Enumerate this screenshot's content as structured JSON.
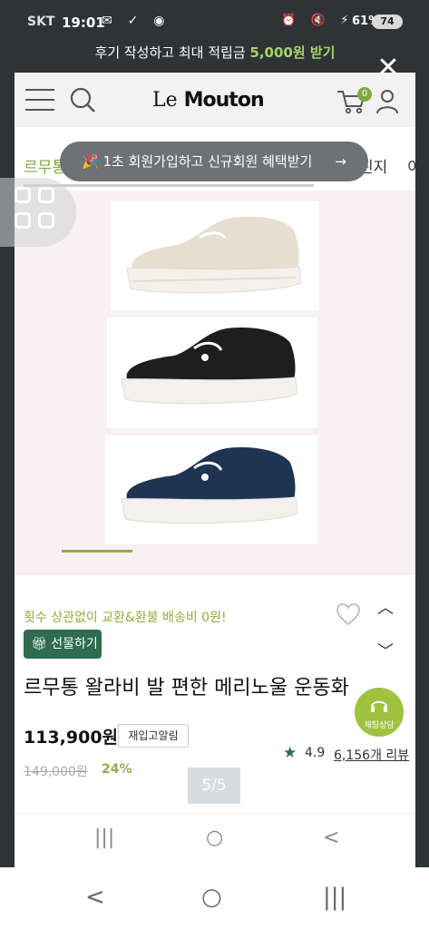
{
  "status_bar": {
    "carrier": "SKT",
    "time": "19:01",
    "battery": "61%",
    "battery_pill": "74"
  },
  "promo_banner": {
    "text": "후기 작성하고 최대 적립금 ",
    "highlight": "5,000원 받기"
  },
  "header": {
    "logo_le": "Le",
    "logo_mouton": "Mouton",
    "cart_count": "0"
  },
  "categories": {
    "first": "르무통",
    "middle": "린지",
    "last": "이"
  },
  "signup_pill": {
    "text": "🎉 1초 회원가입하고 신규회원 혜택받기",
    "arrow": "→"
  },
  "product": {
    "free_shipping": "횟수 상관없이 교환&환불 배송비 0원!",
    "gift_label": "선물하기",
    "title": "르무통 왈라비 발 편한 메리노울 운동화",
    "price": "113,900원",
    "restock_label": "재입고알림",
    "rating": "4.9",
    "reviews": "6,156개 리뷰",
    "original_price": "149,000원",
    "discount": "24%",
    "image_counter": "5/5",
    "shoes": [
      {
        "name": "beige-shoe",
        "color": "#e6dfcf"
      },
      {
        "name": "black-shoe",
        "color": "#1e1e1e"
      },
      {
        "name": "navy-shoe",
        "color": "#1f3352"
      }
    ]
  },
  "chat_button": {
    "label": "채팅상담"
  },
  "app_nav": {
    "recents": "|||",
    "home": "○",
    "back": "<"
  },
  "system_nav": {
    "back": "<",
    "home": "○",
    "recents": "|||"
  },
  "colors": {
    "accent_green": "#7fa83f",
    "dark_green": "#2e6b4f",
    "overlay": "#2f3336"
  }
}
